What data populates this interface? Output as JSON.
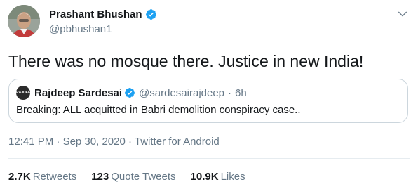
{
  "tweet": {
    "author": {
      "name": "Prashant Bhushan",
      "handle": "@pbhushan1"
    },
    "text": "There was no mosque there. Justice in new India!",
    "quoted": {
      "avatar_text": "RAJDEEP",
      "name": "Rajdeep Sardesai",
      "handle": "@sardesairajdeep",
      "dot": "·",
      "time": "6h",
      "text": "Breaking: ALL acquitted in Babri demolition conspiracy case.."
    },
    "meta": {
      "time": "12:41 PM",
      "sep1": "·",
      "date": "Sep 30, 2020",
      "sep2": "·",
      "source": "Twitter for Android"
    },
    "stats": {
      "retweets_count": "2.7K",
      "retweets_label": "Retweets",
      "quotes_count": "123",
      "quotes_label": "Quote Tweets",
      "likes_count": "10.9K",
      "likes_label": "Likes"
    }
  },
  "colors": {
    "verified": "#1da1f2",
    "secondary_text": "#657786",
    "primary_text": "#14171a",
    "border": "#ccd6dd"
  },
  "icons": {
    "verified": "verified-badge-icon",
    "caret": "chevron-down-icon"
  }
}
